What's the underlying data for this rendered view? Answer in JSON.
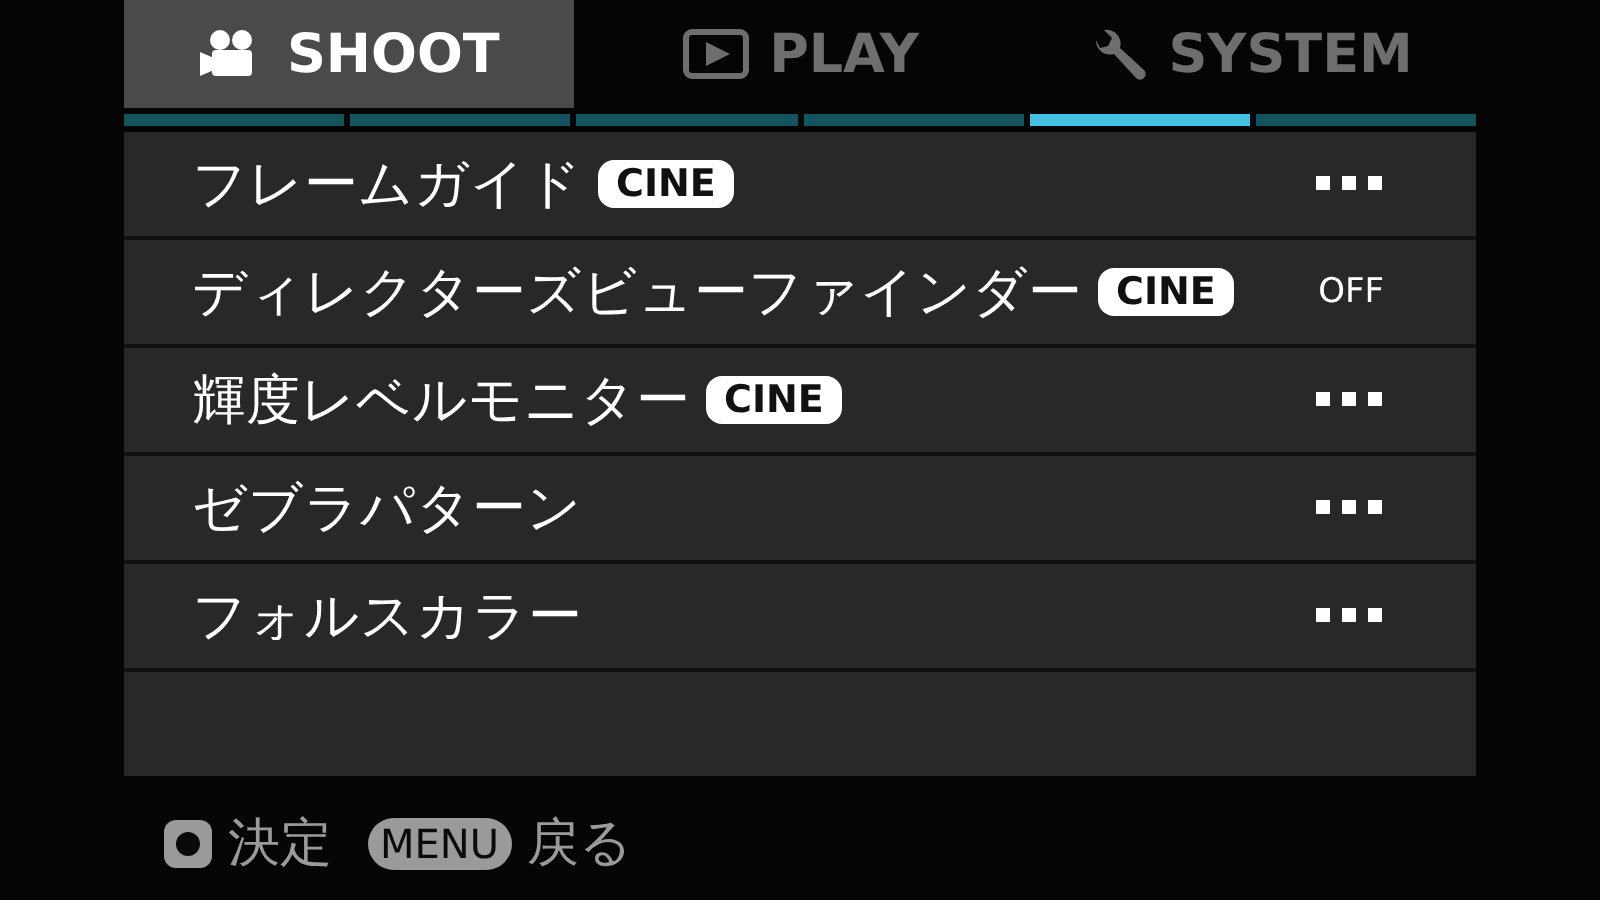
{
  "tabs": [
    {
      "label": "SHOOT",
      "kind": "camera",
      "selected": true
    },
    {
      "label": "PLAY",
      "kind": "play",
      "selected": false
    },
    {
      "label": "SYSTEM",
      "kind": "wrench",
      "selected": false
    }
  ],
  "pages": [
    {
      "selected": false
    },
    {
      "selected": false
    },
    {
      "selected": false
    },
    {
      "selected": false
    },
    {
      "selected": true
    },
    {
      "selected": false
    }
  ],
  "rows": [
    {
      "label": "フレームガイド",
      "badge": "CINE",
      "kind": "more"
    },
    {
      "label": "ディレクターズビューファインダー",
      "badge": "CINE",
      "kind": "text",
      "value": "OFF"
    },
    {
      "label": "輝度レベルモニター",
      "badge": "CINE",
      "kind": "more"
    },
    {
      "label": "ゼブラパターン",
      "kind": "more"
    },
    {
      "label": "フォルスカラー",
      "kind": "more"
    }
  ],
  "footer": {
    "confirm": "決定",
    "menu_key": "MENU",
    "back": "戻る"
  }
}
